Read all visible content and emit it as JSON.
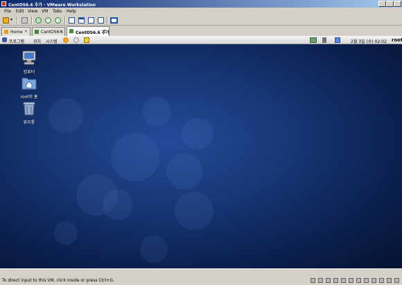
{
  "window": {
    "title": "CentOS6.6 추가 - VMware Workstation"
  },
  "menu": {
    "items": [
      "File",
      "Edit",
      "View",
      "VM",
      "Tabs",
      "Help"
    ]
  },
  "tabs": [
    {
      "label": "Home",
      "close": "×"
    },
    {
      "label": "CentOS6.6",
      "close": "×"
    },
    {
      "label": "CentOS6.6 추가",
      "close": "×",
      "active": true
    }
  ],
  "guest_panel": {
    "menus": [
      "프로그램",
      "위치",
      "시스템"
    ],
    "datetime": "2월  3일 (수) 02:02",
    "user": "root"
  },
  "desktop": {
    "icons": [
      {
        "label": "컴퓨터",
        "icon": "computer-icon"
      },
      {
        "label": "root의 홈",
        "icon": "home-folder-icon"
      },
      {
        "label": "휴지통",
        "icon": "trash-icon"
      }
    ]
  },
  "statusbar": {
    "message": "To direct input to this VM, click inside or press Ctrl+G."
  },
  "colors": {
    "titlebar_start": "#0a246a",
    "desktop_center": "#254a98",
    "desktop_edge": "#061330"
  }
}
